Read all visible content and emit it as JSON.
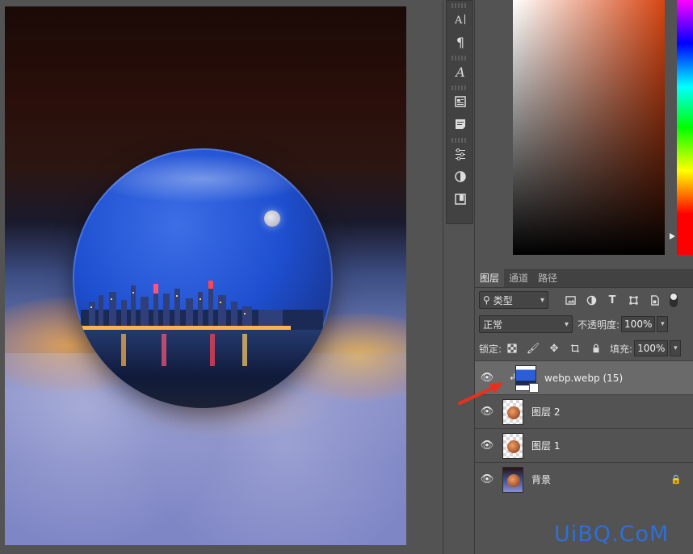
{
  "toolbar": {
    "tools": [
      "character-panel-icon",
      "paragraph-panel-icon",
      "glyphs-icon",
      "paragraph-styles-icon",
      "character-styles-icon",
      "adjustments-icon",
      "adjustment-half-icon",
      "libraries-icon"
    ]
  },
  "color_panel": {
    "base_hue": "#d64512"
  },
  "layers_panel": {
    "tabs": [
      "图层",
      "通道",
      "路径"
    ],
    "active_tab": "图层",
    "filter": {
      "label": "类型"
    },
    "blend_mode": "正常",
    "opacity_label": "不透明度:",
    "opacity_value": "100%",
    "lock_label": "锁定:",
    "fill_label": "填充:",
    "fill_value": "100%",
    "layers": [
      {
        "name": "webp.webp (15)",
        "selected": true,
        "visible": true,
        "clipped": true,
        "smart_object": true
      },
      {
        "name": "图层 2",
        "selected": false,
        "visible": true
      },
      {
        "name": "图层 1",
        "selected": false,
        "visible": true
      },
      {
        "name": "背景",
        "selected": false,
        "visible": true,
        "locked": true
      }
    ]
  },
  "watermark": {
    "text": "UiBQ.CoM",
    "color": "#2e6fd6"
  }
}
